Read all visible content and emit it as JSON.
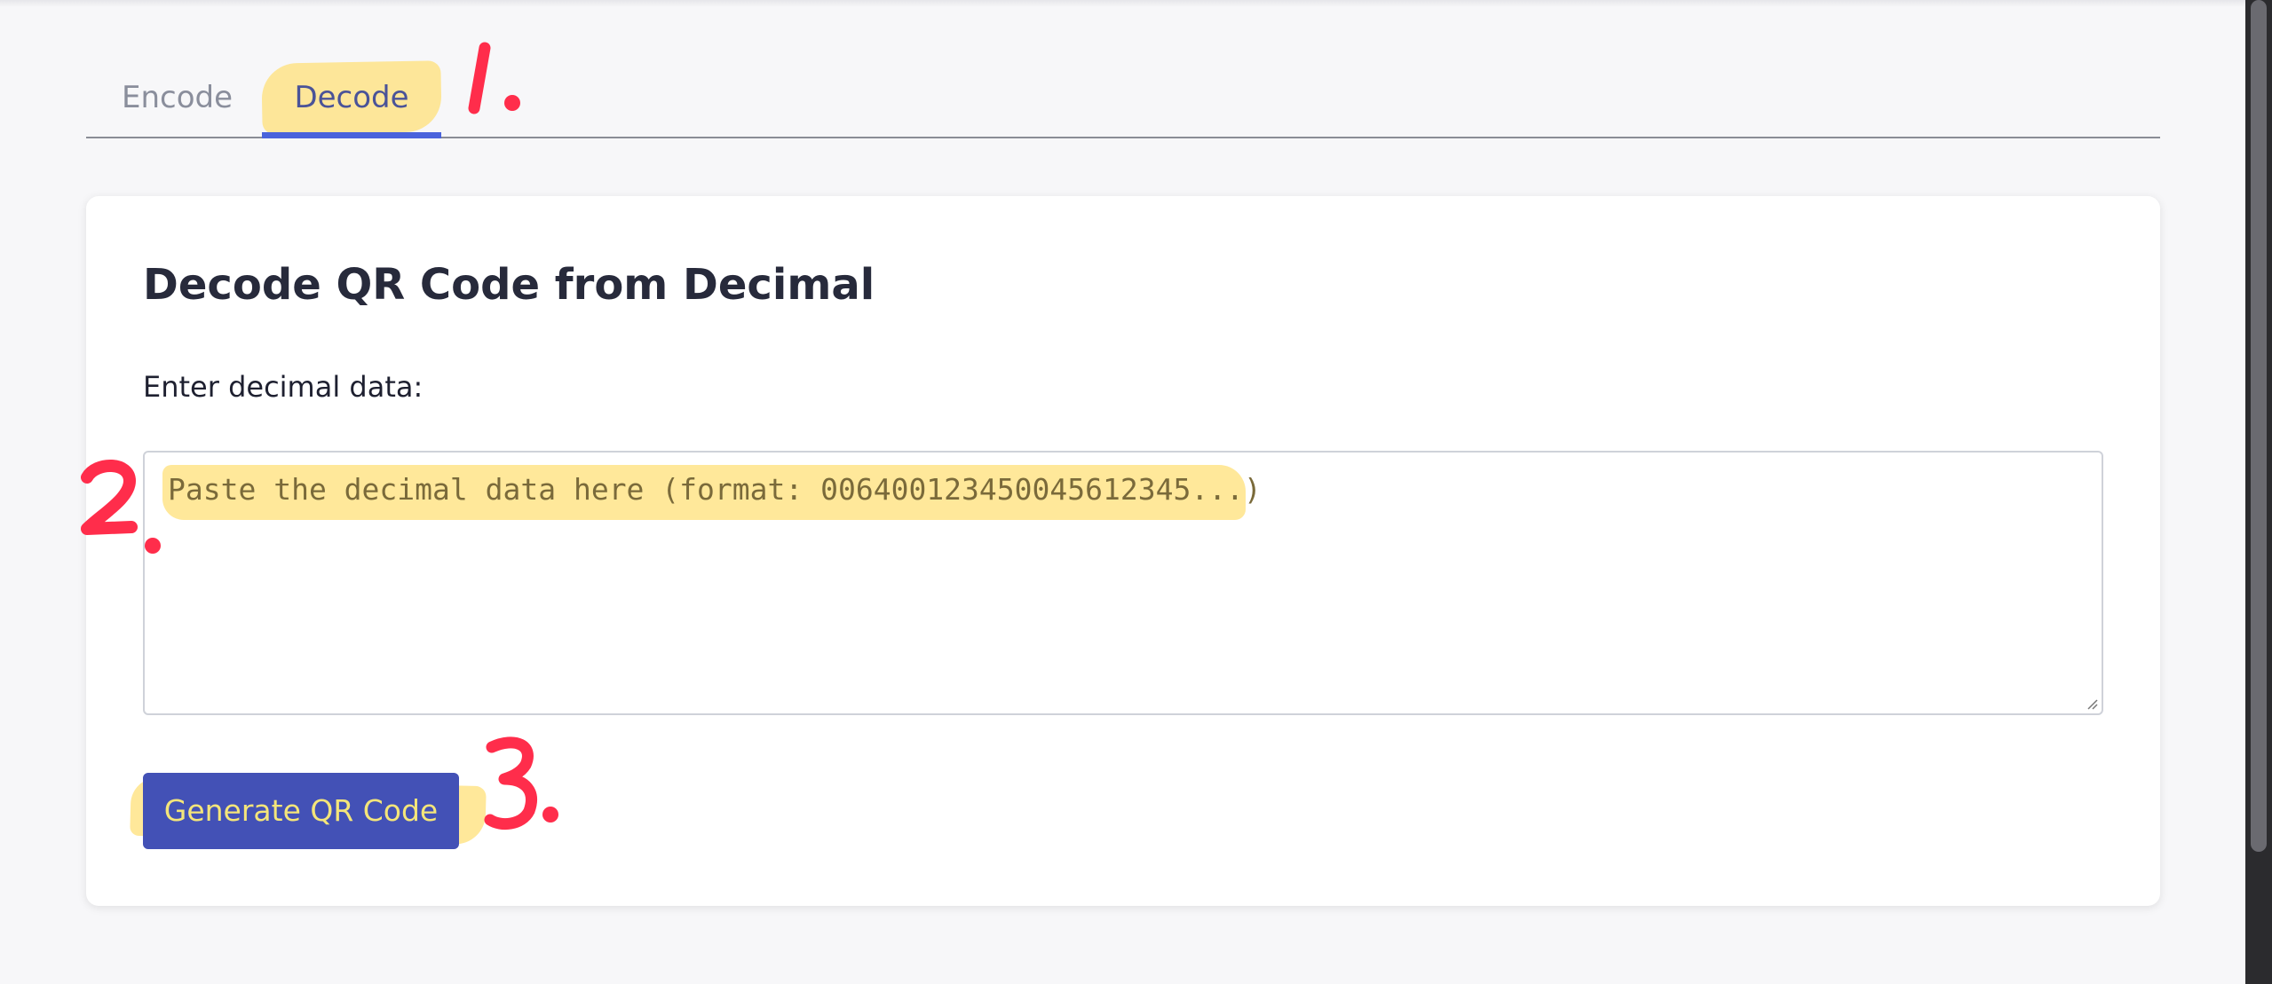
{
  "tabs": {
    "encode_label": "Encode",
    "decode_label": "Decode",
    "active": "Decode"
  },
  "card": {
    "title": "Decode QR Code from Decimal",
    "input_label": "Enter decimal data:",
    "textarea_placeholder": "Paste the decimal data here (format: 00640012345004561234​5...)",
    "button_label": "Generate QR Code"
  },
  "annotations": {
    "step1": "1.",
    "step2": "2.",
    "step3": "3."
  },
  "colors": {
    "accent": "#4a63dc",
    "highlight": "#ffe078",
    "annotation_red": "#ff2d4b"
  }
}
